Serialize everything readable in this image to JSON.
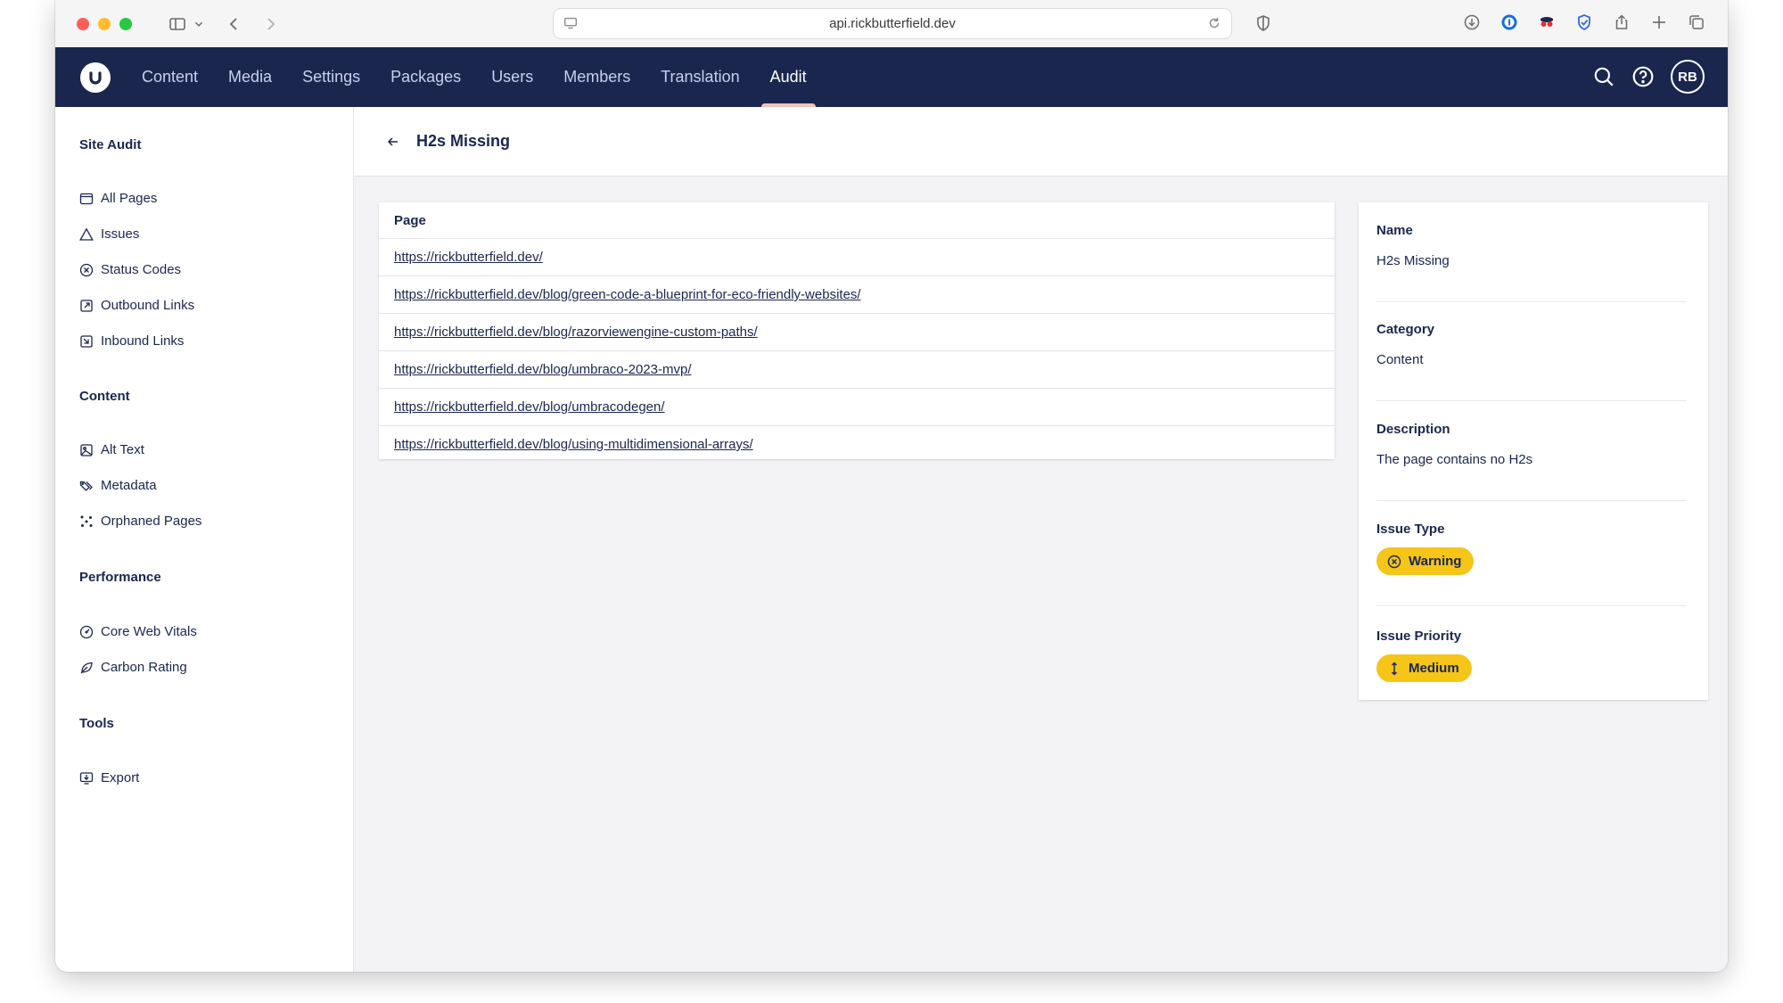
{
  "browser": {
    "url": "api.rickbutterfield.dev"
  },
  "appbar": {
    "nav": [
      {
        "label": "Content"
      },
      {
        "label": "Media"
      },
      {
        "label": "Settings"
      },
      {
        "label": "Packages"
      },
      {
        "label": "Users"
      },
      {
        "label": "Members"
      },
      {
        "label": "Translation"
      },
      {
        "label": "Audit",
        "active": true
      }
    ],
    "avatar_initials": "RB"
  },
  "sidebar": {
    "groups": [
      {
        "title": "Site Audit",
        "items": [
          {
            "label": "All Pages",
            "icon": "browser-window-icon"
          },
          {
            "label": "Issues",
            "icon": "warning-triangle-icon"
          },
          {
            "label": "Status Codes",
            "icon": "circle-x-icon"
          },
          {
            "label": "Outbound Links",
            "icon": "external-link-icon"
          },
          {
            "label": "Inbound Links",
            "icon": "inbound-link-icon"
          }
        ]
      },
      {
        "title": "Content",
        "items": [
          {
            "label": "Alt Text",
            "icon": "image-icon"
          },
          {
            "label": "Metadata",
            "icon": "tags-icon"
          },
          {
            "label": "Orphaned Pages",
            "icon": "scatter-icon"
          }
        ]
      },
      {
        "title": "Performance",
        "items": [
          {
            "label": "Core Web Vitals",
            "icon": "gauge-icon"
          },
          {
            "label": "Carbon Rating",
            "icon": "leaf-icon"
          }
        ]
      },
      {
        "title": "Tools",
        "items": [
          {
            "label": "Export",
            "icon": "export-icon"
          }
        ]
      }
    ]
  },
  "main": {
    "title": "H2s Missing",
    "table": {
      "header": "Page",
      "rows": [
        "https://rickbutterfield.dev/",
        "https://rickbutterfield.dev/blog/green-code-a-blueprint-for-eco-friendly-websites/",
        "https://rickbutterfield.dev/blog/razorviewengine-custom-paths/",
        "https://rickbutterfield.dev/blog/umbraco-2023-mvp/",
        "https://rickbutterfield.dev/blog/umbracodegen/",
        "https://rickbutterfield.dev/blog/using-multidimensional-arrays/"
      ]
    },
    "details": {
      "name_label": "Name",
      "name_value": "H2s Missing",
      "category_label": "Category",
      "category_value": "Content",
      "description_label": "Description",
      "description_value": "The page contains no H2s",
      "issue_type_label": "Issue Type",
      "issue_type_value": "Warning",
      "issue_priority_label": "Issue Priority",
      "issue_priority_value": "Medium"
    }
  },
  "colors": {
    "header_bg": "#1b264f",
    "active_tab_indicator": "#f5c1bc",
    "pill_bg": "#f5c518",
    "main_bg": "#f3f3f5"
  }
}
